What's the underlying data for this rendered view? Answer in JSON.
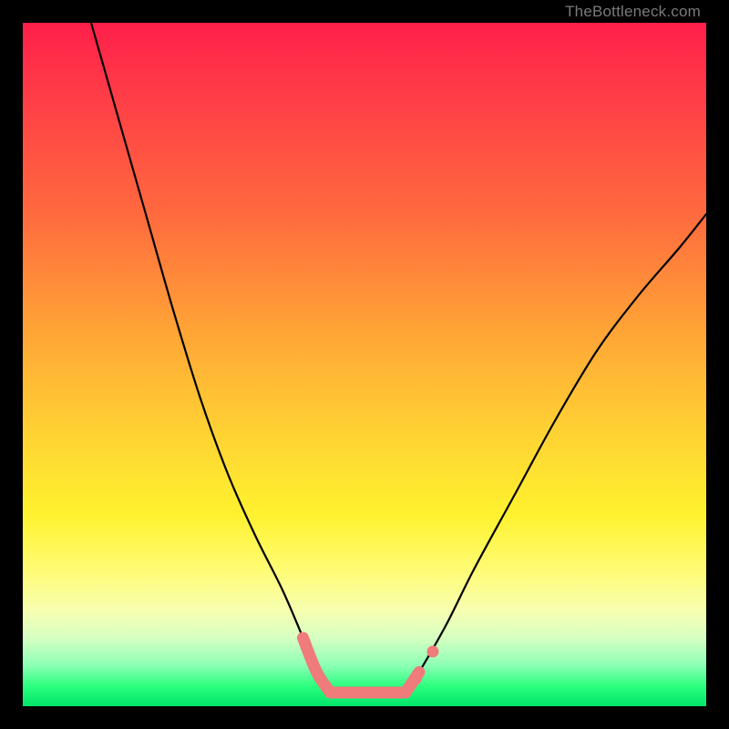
{
  "watermark": {
    "text": "TheBottleneck.com"
  },
  "chart_data": {
    "type": "line",
    "title": "",
    "xlabel": "",
    "ylabel": "",
    "xlim": [
      0,
      100
    ],
    "ylim": [
      0,
      100
    ],
    "grid": false,
    "legend": false,
    "series": [
      {
        "name": "left-curve",
        "x": [
          10,
          14,
          18,
          22,
          26,
          30,
          34,
          38,
          41,
          43,
          45
        ],
        "y": [
          100,
          86,
          72,
          58,
          45,
          34,
          25,
          17,
          10,
          5,
          2
        ]
      },
      {
        "name": "right-curve",
        "x": [
          56,
          58,
          62,
          66,
          72,
          78,
          84,
          90,
          96,
          100
        ],
        "y": [
          2,
          5,
          12,
          20,
          31,
          42,
          52,
          60,
          67,
          72
        ]
      },
      {
        "name": "floor-band",
        "x": [
          45,
          56
        ],
        "y": [
          2,
          2
        ]
      }
    ],
    "annotations": [
      {
        "name": "floor-dot-right-1",
        "x": 57.5,
        "y": 4
      },
      {
        "name": "floor-dot-right-2",
        "x": 60,
        "y": 8
      }
    ],
    "background_gradient": {
      "orientation": "vertical",
      "stops": [
        {
          "pos": 0.0,
          "color": "#ff1f4a"
        },
        {
          "pos": 0.45,
          "color": "#ffa436"
        },
        {
          "pos": 0.72,
          "color": "#fff22f"
        },
        {
          "pos": 0.9,
          "color": "#d6ffc2"
        },
        {
          "pos": 1.0,
          "color": "#00e66a"
        }
      ]
    }
  }
}
